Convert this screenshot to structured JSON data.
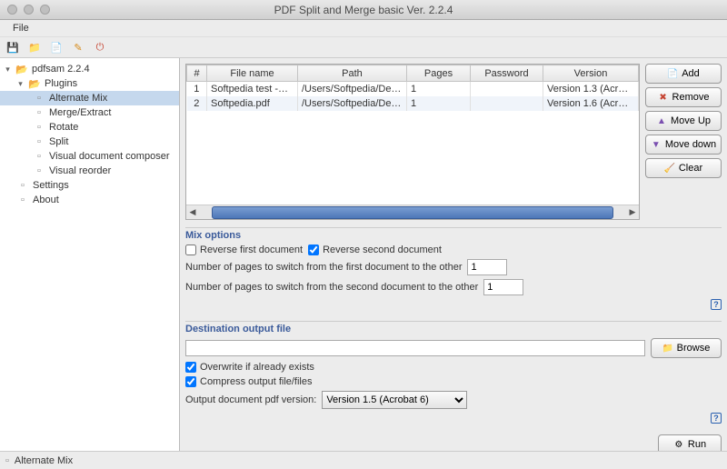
{
  "window": {
    "title": "PDF Split and Merge basic Ver. 2.2.4"
  },
  "menubar": {
    "file": "File"
  },
  "toolbar": {
    "save": "save-icon",
    "open": "open-icon",
    "log": "log-icon",
    "edit": "edit-icon",
    "exit": "exit-icon"
  },
  "tree": {
    "root": "pdfsam 2.2.4",
    "plugins": "Plugins",
    "items": [
      "Alternate Mix",
      "Merge/Extract",
      "Rotate",
      "Split",
      "Visual document composer",
      "Visual reorder"
    ],
    "settings": "Settings",
    "about": "About"
  },
  "table": {
    "headers": {
      "num": "#",
      "filename": "File name",
      "path": "Path",
      "pages": "Pages",
      "password": "Password",
      "version": "Version"
    },
    "rows": [
      {
        "num": "1",
        "filename": "Softpedia test -…",
        "path": "/Users/Softpedia/De…",
        "pages": "1",
        "password": "",
        "version": "Version 1.3 (Acr…"
      },
      {
        "num": "2",
        "filename": "Softpedia.pdf",
        "path": "/Users/Softpedia/De…",
        "pages": "1",
        "password": "",
        "version": "Version 1.6 (Acr…"
      }
    ]
  },
  "buttons": {
    "add": "Add",
    "remove": "Remove",
    "moveup": "Move Up",
    "movedown": "Move down",
    "clear": "Clear",
    "browse": "Browse",
    "run": "Run"
  },
  "mix": {
    "title": "Mix options",
    "reverse_first": "Reverse first document",
    "reverse_second": "Reverse second document",
    "switch_first_label": "Number of pages to switch from the first document to the other",
    "switch_second_label": "Number of pages to switch from the second document to the other",
    "switch_first_value": "1",
    "switch_second_value": "1"
  },
  "dest": {
    "title": "Destination output file",
    "value": "",
    "overwrite": "Overwrite if already exists",
    "compress": "Compress output file/files",
    "outver_label": "Output document pdf version:",
    "outver_value": "Version 1.5 (Acrobat 6)"
  },
  "status": {
    "text": "Alternate Mix"
  },
  "help": "?"
}
